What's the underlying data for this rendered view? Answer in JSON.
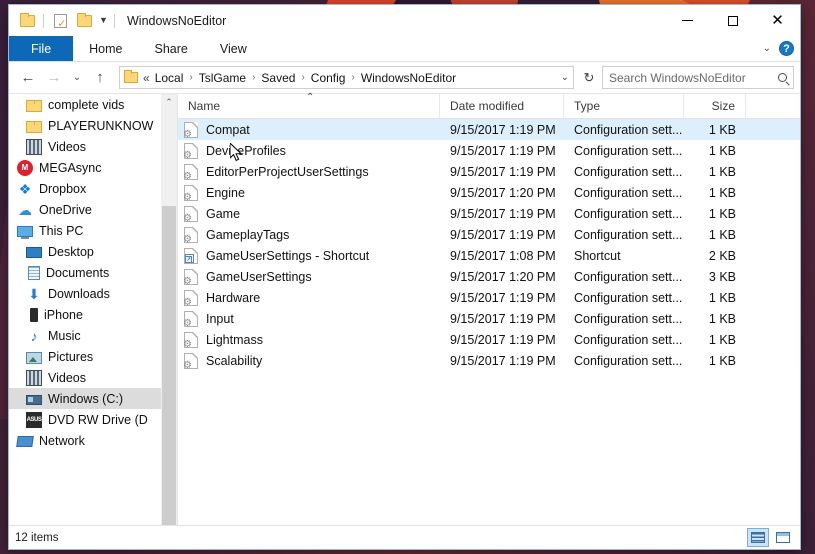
{
  "window": {
    "title": "WindowsNoEditor",
    "quick_access": [
      {
        "name": "folder-icon",
        "label": "Folder"
      },
      {
        "name": "properties-icon",
        "label": "Properties"
      },
      {
        "name": "new-folder-icon",
        "label": "New folder"
      },
      {
        "name": "customize-dropdown-icon",
        "label": "Customize Quick Access Toolbar"
      }
    ],
    "controls": {
      "minimize": "Minimize",
      "maximize": "Maximize",
      "close": "Close"
    }
  },
  "ribbon": {
    "tabs": [
      {
        "label": "File",
        "active": true
      },
      {
        "label": "Home",
        "active": false
      },
      {
        "label": "Share",
        "active": false
      },
      {
        "label": "View",
        "active": false
      }
    ],
    "expand_label": "Expand the Ribbon",
    "help_label": "?"
  },
  "addressbar": {
    "back": "←",
    "forward": "→",
    "recent": "⌄",
    "up": "↑",
    "overflow": "«",
    "crumbs": [
      "Local",
      "TslGame",
      "Saved",
      "Config",
      "WindowsNoEditor"
    ],
    "separator": "›",
    "dropdown": "⌄",
    "refresh": "↻"
  },
  "search": {
    "placeholder": "Search WindowsNoEditor",
    "icon": "search-icon"
  },
  "sidebar": {
    "items": [
      {
        "label": "complete vids",
        "icon": "folder-icon",
        "indent": 1,
        "selected": false
      },
      {
        "label": "PLAYERUNKNOW",
        "icon": "folder-icon",
        "indent": 1,
        "selected": false
      },
      {
        "label": "Videos",
        "icon": "videos-icon",
        "indent": 1,
        "selected": false
      },
      {
        "label": "MEGAsync",
        "icon": "megasync-icon",
        "indent": 0,
        "selected": false
      },
      {
        "label": "Dropbox",
        "icon": "dropbox-icon",
        "indent": 0,
        "selected": false
      },
      {
        "label": "OneDrive",
        "icon": "onedrive-icon",
        "indent": 0,
        "selected": false
      },
      {
        "label": "This PC",
        "icon": "this-pc-icon",
        "indent": 0,
        "selected": false
      },
      {
        "label": "Desktop",
        "icon": "desktop-icon",
        "indent": 1,
        "selected": false
      },
      {
        "label": "Documents",
        "icon": "documents-icon",
        "indent": 1,
        "selected": false
      },
      {
        "label": "Downloads",
        "icon": "downloads-icon",
        "indent": 1,
        "selected": false
      },
      {
        "label": "iPhone",
        "icon": "phone-icon",
        "indent": 1,
        "selected": false
      },
      {
        "label": "Music",
        "icon": "music-icon",
        "indent": 1,
        "selected": false
      },
      {
        "label": "Pictures",
        "icon": "pictures-icon",
        "indent": 1,
        "selected": false
      },
      {
        "label": "Videos",
        "icon": "videos-icon",
        "indent": 1,
        "selected": false
      },
      {
        "label": "Windows (C:)",
        "icon": "drive-icon",
        "indent": 1,
        "selected": true
      },
      {
        "label": "DVD RW Drive (D",
        "icon": "dvd-drive-icon",
        "indent": 1,
        "selected": false
      },
      {
        "label": "Network",
        "icon": "network-icon",
        "indent": 0,
        "selected": false
      }
    ],
    "scrollbar": {
      "up": "⌃",
      "down": "⌄"
    }
  },
  "filelist": {
    "columns": [
      "Name",
      "Date modified",
      "Type",
      "Size"
    ],
    "sort_column": "Name",
    "sort_direction": "ascending",
    "rows": [
      {
        "name": "Compat",
        "date": "9/15/2017 1:19 PM",
        "type": "Configuration sett...",
        "size": "1 KB",
        "icon": "config-file-icon",
        "selected": true
      },
      {
        "name": "DeviceProfiles",
        "date": "9/15/2017 1:19 PM",
        "type": "Configuration sett...",
        "size": "1 KB",
        "icon": "config-file-icon",
        "selected": false
      },
      {
        "name": "EditorPerProjectUserSettings",
        "date": "9/15/2017 1:19 PM",
        "type": "Configuration sett...",
        "size": "1 KB",
        "icon": "config-file-icon",
        "selected": false
      },
      {
        "name": "Engine",
        "date": "9/15/2017 1:20 PM",
        "type": "Configuration sett...",
        "size": "1 KB",
        "icon": "config-file-icon",
        "selected": false
      },
      {
        "name": "Game",
        "date": "9/15/2017 1:19 PM",
        "type": "Configuration sett...",
        "size": "1 KB",
        "icon": "config-file-icon",
        "selected": false
      },
      {
        "name": "GameplayTags",
        "date": "9/15/2017 1:19 PM",
        "type": "Configuration sett...",
        "size": "1 KB",
        "icon": "config-file-icon",
        "selected": false
      },
      {
        "name": "GameUserSettings - Shortcut",
        "date": "9/15/2017 1:08 PM",
        "type": "Shortcut",
        "size": "2 KB",
        "icon": "shortcut-file-icon",
        "selected": false
      },
      {
        "name": "GameUserSettings",
        "date": "9/15/2017 1:20 PM",
        "type": "Configuration sett...",
        "size": "3 KB",
        "icon": "config-file-icon",
        "selected": false
      },
      {
        "name": "Hardware",
        "date": "9/15/2017 1:19 PM",
        "type": "Configuration sett...",
        "size": "1 KB",
        "icon": "config-file-icon",
        "selected": false
      },
      {
        "name": "Input",
        "date": "9/15/2017 1:19 PM",
        "type": "Configuration sett...",
        "size": "1 KB",
        "icon": "config-file-icon",
        "selected": false
      },
      {
        "name": "Lightmass",
        "date": "9/15/2017 1:19 PM",
        "type": "Configuration sett...",
        "size": "1 KB",
        "icon": "config-file-icon",
        "selected": false
      },
      {
        "name": "Scalability",
        "date": "9/15/2017 1:19 PM",
        "type": "Configuration sett...",
        "size": "1 KB",
        "icon": "config-file-icon",
        "selected": false
      }
    ]
  },
  "statusbar": {
    "item_count": "12 items",
    "views": [
      {
        "name": "details-view-button",
        "label": "Details view",
        "active": true
      },
      {
        "name": "large-icons-view-button",
        "label": "Large icons view",
        "active": false
      }
    ]
  },
  "colors": {
    "accent": "#0e68b8",
    "selection": "#ddeffc",
    "nav_selection": "#dcdcdc",
    "folder": "#fcd77a"
  }
}
